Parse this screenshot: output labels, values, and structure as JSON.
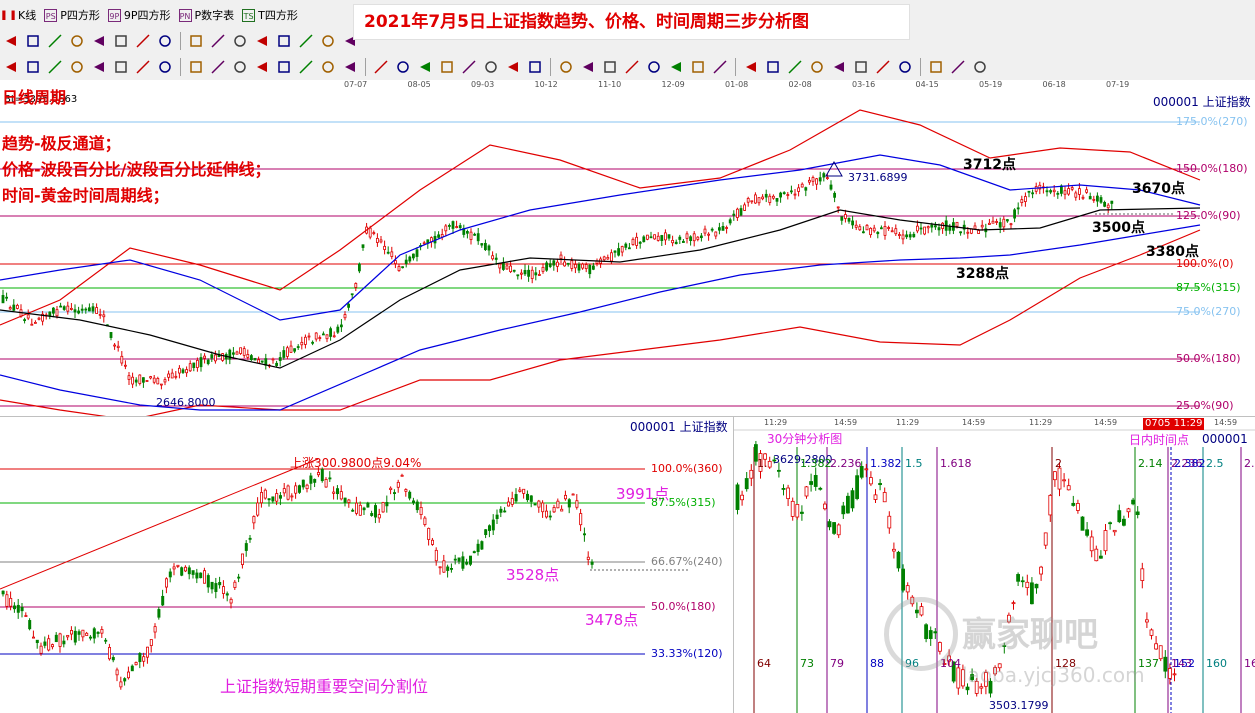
{
  "banner_title": "2021年7月5日上证指数趋势、价格、时间周期三步分析图",
  "toolbar": {
    "tabs": [
      {
        "label": "K线",
        "icon": "candle-icon"
      },
      {
        "label": "P四方形",
        "icon": "ps-icon"
      },
      {
        "label": "9P四方形",
        "icon": "9p-icon"
      },
      {
        "label": "P数字表",
        "icon": "pn-icon"
      },
      {
        "label": "T四方形",
        "icon": "ts-icon"
      }
    ]
  },
  "top_chart": {
    "code_label": "000001  上证指数",
    "bt_label": "Bt=3395.0663",
    "date_ticks": [
      "07-07",
      "08-05",
      "09-03",
      "10-12",
      "11-10",
      "12-09",
      "01-08",
      "02-08",
      "03-16",
      "04-15",
      "05-19",
      "06-18",
      "07-19"
    ],
    "annotations": {
      "period": "日线周期",
      "trend": "趋势-极反通道；",
      "price": "价格-波段百分比/波段百分比延伸线；",
      "time": "时间-黄金时间周期线；"
    },
    "levels": [
      {
        "label": "175.0%(270)",
        "color": "#87c3f0"
      },
      {
        "label": "150.0%(180)",
        "color": "#b0006a"
      },
      {
        "label": "125.0%(90)",
        "color": "#b0006a"
      },
      {
        "label": "100.0%(0)",
        "color": "#e00000"
      },
      {
        "label": "87.5%(315)",
        "color": "#00b000"
      },
      {
        "label": "75.0%(270)",
        "color": "#87c3f0"
      },
      {
        "label": "50.0%(180)",
        "color": "#b0006a"
      },
      {
        "label": "25.0%(90)",
        "color": "#b0006a"
      }
    ],
    "point_labels": {
      "high": "3731.6899",
      "low": "2646.8000",
      "p3712": "3712点",
      "p3670": "3670点",
      "p3500": "3500点",
      "p3380": "3380点",
      "p3288": "3288点"
    }
  },
  "bottom_left_chart": {
    "code_label": "000001  上证指数",
    "rise_label": "上涨300.9800点9.04%",
    "levels": [
      {
        "label": "100.0%(360)",
        "color": "#e00000"
      },
      {
        "label": "87.5%(315)",
        "color": "#00b000"
      },
      {
        "label": "66.67%(240)",
        "color": "#808080"
      },
      {
        "label": "50.0%(180)",
        "color": "#b0006a"
      },
      {
        "label": "33.33%(120)",
        "color": "#0000c0"
      }
    ],
    "point_labels": {
      "p3991": "3991点",
      "p3528": "3528点",
      "p3478": "3478点"
    },
    "footer": "上证指数短期重要空间分割位"
  },
  "bottom_right_chart": {
    "title": "30分钟分析图",
    "intraday_label": "日内时间点",
    "code_label": "000001",
    "current_time": "0705 11:29",
    "time_ticks": [
      "11:29",
      "14:59",
      "11:29",
      "14:59",
      "11:29",
      "14:59",
      "14:59"
    ],
    "high_label": "3629.2800",
    "low_label": "3503.1799",
    "ratio_labels": [
      "1.",
      "1.382",
      "2.236",
      "1.382",
      "1.5",
      "1.618",
      "2",
      "2.14",
      "2.236",
      "2.382",
      "2.5",
      "2.6"
    ],
    "count_labels": [
      "64",
      "73",
      "79",
      "88",
      "96",
      "104",
      "128",
      "137",
      "143",
      "152",
      "160",
      "168"
    ],
    "watermark": "赢家聊吧",
    "watermark_url": "laoba.yjcj360.com"
  },
  "chart_data": [
    {
      "type": "candlestick",
      "title": "日线周期",
      "x_ticks": [
        "07-07",
        "08-05",
        "09-03",
        "10-12",
        "11-10",
        "12-09",
        "01-08",
        "02-08",
        "03-16",
        "04-15",
        "05-19",
        "06-18",
        "07-19"
      ],
      "series": [
        {
          "name": "上证指数",
          "points_approx": [
            {
              "x": "07-07",
              "close": 3330
            },
            {
              "x": "08-05",
              "close": 3310
            },
            {
              "x": "09-03",
              "close": 3390
            },
            {
              "x": "10-12",
              "close": 3360
            },
            {
              "x": "11-10",
              "close": 3350
            },
            {
              "x": "12-09",
              "close": 3400
            },
            {
              "x": "01-08",
              "close": 3570
            },
            {
              "x": "02-08",
              "close": 3530
            },
            {
              "x": "03-16",
              "close": 3450
            },
            {
              "x": "04-15",
              "close": 3430
            },
            {
              "x": "05-19",
              "close": 3510
            },
            {
              "x": "06-18",
              "close": 3540
            },
            {
              "x": "07-19",
              "close": 3530
            }
          ]
        }
      ],
      "marked_high": 3731.6899,
      "marked_low": 2646.8,
      "levels_pct": [
        175.0,
        150.0,
        125.0,
        100.0,
        87.5,
        75.0,
        50.0,
        25.0
      ]
    },
    {
      "type": "candlestick",
      "title": "上证指数短期重要空间分割位",
      "rise_points": 300.98,
      "rise_pct": 9.04,
      "levels_pct": [
        100.0,
        87.5,
        66.67,
        50.0,
        33.33
      ],
      "key_points": [
        3991,
        3528,
        3478
      ]
    },
    {
      "type": "candlestick",
      "title": "30分钟分析图",
      "marked_high": 3629.28,
      "marked_low": 3503.1799,
      "count_lines": [
        64,
        73,
        79,
        88,
        96,
        104,
        128,
        137,
        143,
        152,
        160,
        168
      ]
    }
  ]
}
